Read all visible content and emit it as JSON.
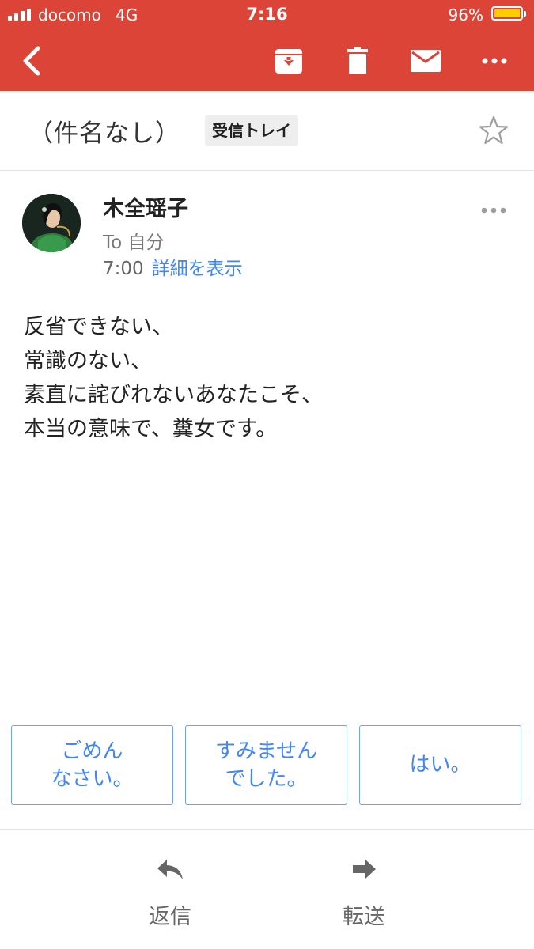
{
  "status_bar": {
    "carrier": "docomo",
    "network": "4G",
    "time": "7:16",
    "battery_percent": "96%",
    "battery_level": 0.96
  },
  "colors": {
    "header": "#db4437",
    "link": "#4285f4",
    "reply_border": "#6ea1ef",
    "battery": "#ffcc00"
  },
  "toolbar": {
    "icons": [
      "back-arrow-icon",
      "archive-icon",
      "trash-icon",
      "mail-icon",
      "more-icon"
    ]
  },
  "email": {
    "subject": "（件名なし）",
    "label": "受信トレイ",
    "sender": "木全瑶子",
    "to": "To 自分",
    "time": "7:00",
    "details_link": "詳細を表示",
    "body": [
      "反省できない、",
      "常識のない、",
      "素直に詫びれないあなたこそ、",
      "本当の意味で、糞女です。"
    ]
  },
  "smart_replies": [
    "ごめん\nなさい。",
    "すみません\nでした。",
    "はい。"
  ],
  "actions": {
    "reply": "返信",
    "forward": "転送"
  }
}
